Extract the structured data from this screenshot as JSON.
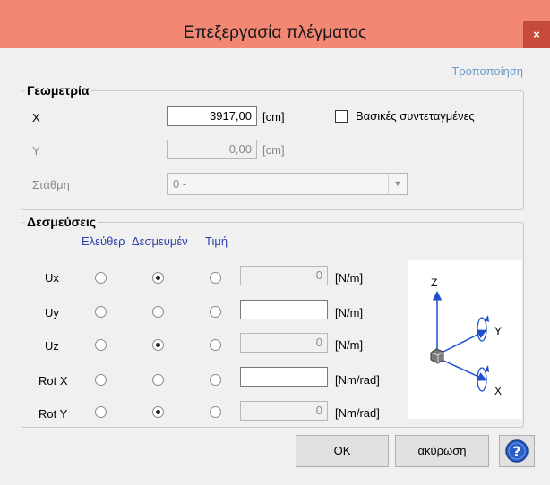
{
  "window": {
    "title": "Επεξεργασία πλέγματος",
    "close": "×"
  },
  "mode_label": "Τροποποίηση",
  "geometry": {
    "title": "Γεωμετρία",
    "x": {
      "label": "X",
      "value": "3917,00",
      "unit": "[cm]"
    },
    "y": {
      "label": "Y",
      "value": "0,00",
      "unit": "[cm]"
    },
    "level": {
      "label": "Στάθμη",
      "value": "0 -"
    },
    "basic_coords": {
      "label": "Βασικές συντεταγμένες",
      "checked": false
    }
  },
  "constraints": {
    "title": "Δεσμεύσεις",
    "columns": [
      "Ελεύθερ",
      "Δεσμευμέν",
      "Τιμή"
    ],
    "rows": [
      {
        "label": "Ux",
        "selected": "fixed",
        "value": "0",
        "unit": "[N/m]"
      },
      {
        "label": "Uy",
        "selected": "none",
        "value": "",
        "unit": "[N/m]"
      },
      {
        "label": "Uz",
        "selected": "fixed",
        "value": "0",
        "unit": "[N/m]"
      },
      {
        "label": "Rot X",
        "selected": "none",
        "value": "",
        "unit": "[Nm/rad]"
      },
      {
        "label": "Rot Y",
        "selected": "fixed",
        "value": "0",
        "unit": "[Nm/rad]"
      }
    ]
  },
  "diagram": {
    "z": "Z",
    "y": "Y",
    "x": "X"
  },
  "buttons": {
    "ok": "OK",
    "cancel": "ακύρωση"
  },
  "icons": {
    "help": "help-icon",
    "close": "close-icon",
    "dropdown": "chevron-down-icon"
  },
  "colors": {
    "titlebar": "#f28774",
    "close": "#c74b3a",
    "header_text": "#2f3fae",
    "mode_text": "#6d9bc7",
    "axis_blue": "#1f4fd0"
  }
}
